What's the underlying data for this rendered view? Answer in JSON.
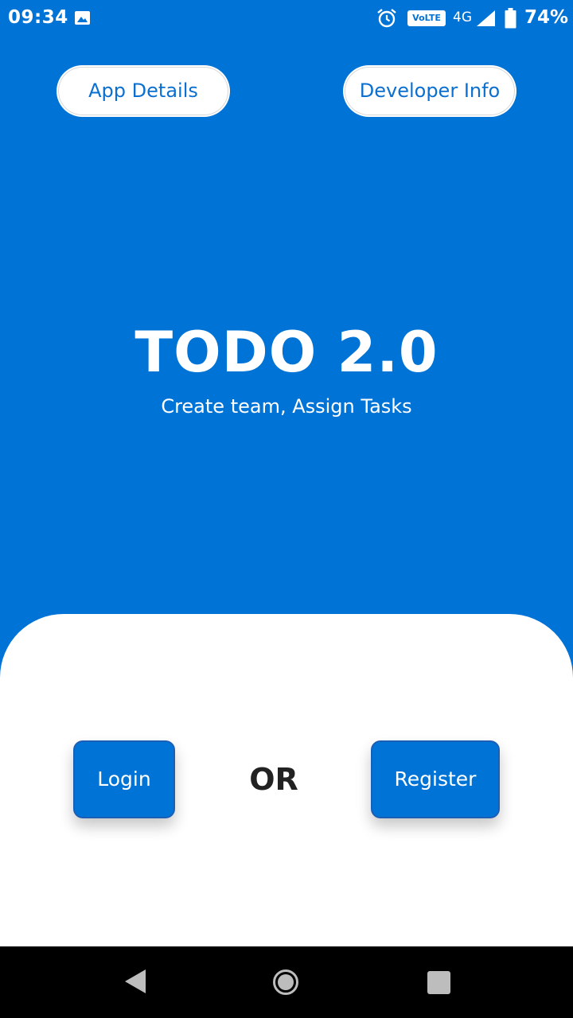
{
  "status_bar": {
    "time": "09:34",
    "volte": "VoLTE",
    "network": "4G",
    "battery": "74%",
    "icons": [
      "image-icon",
      "alarm-icon",
      "signal-icon",
      "battery-icon"
    ]
  },
  "header": {
    "app_details_label": "App Details",
    "developer_info_label": "Developer Info"
  },
  "hero": {
    "title": "TODO 2.0",
    "subtitle": "Create team, Assign Tasks"
  },
  "actions": {
    "login_label": "Login",
    "or_label": "OR",
    "register_label": "Register"
  },
  "nav_bar": {
    "icons": [
      "back-icon",
      "home-icon",
      "recent-apps-icon"
    ]
  },
  "colors": {
    "primary": "#0073d6",
    "surface": "#ffffff",
    "text_dark": "#222222",
    "nav_bar": "#000000"
  }
}
